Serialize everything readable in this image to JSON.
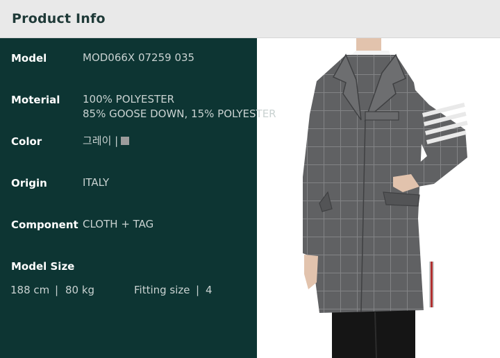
{
  "header": {
    "title": "Product Info"
  },
  "specs": {
    "model": {
      "label": "Model",
      "value": "MOD066X 07259 035"
    },
    "material": {
      "label": "Moterial",
      "line1": "100% POLYESTER",
      "line2": "85% GOOSE DOWN, 15% POLYESTER"
    },
    "color": {
      "label": "Color",
      "value": "그레이 |",
      "swatch_color": "#9c9c9c"
    },
    "origin": {
      "label": "Origin",
      "value": "ITALY"
    },
    "component": {
      "label": "Component",
      "value": "CLOTH + TAG"
    },
    "model_size": {
      "label": "Model Size",
      "height": "188 cm",
      "weight": "80 kg",
      "fitting_label": "Fitting size",
      "fitting_value": "4",
      "separator": "|"
    }
  },
  "colors": {
    "panel": "#0d3533",
    "header": "#e9e9e9",
    "coat": "#5f6062"
  }
}
